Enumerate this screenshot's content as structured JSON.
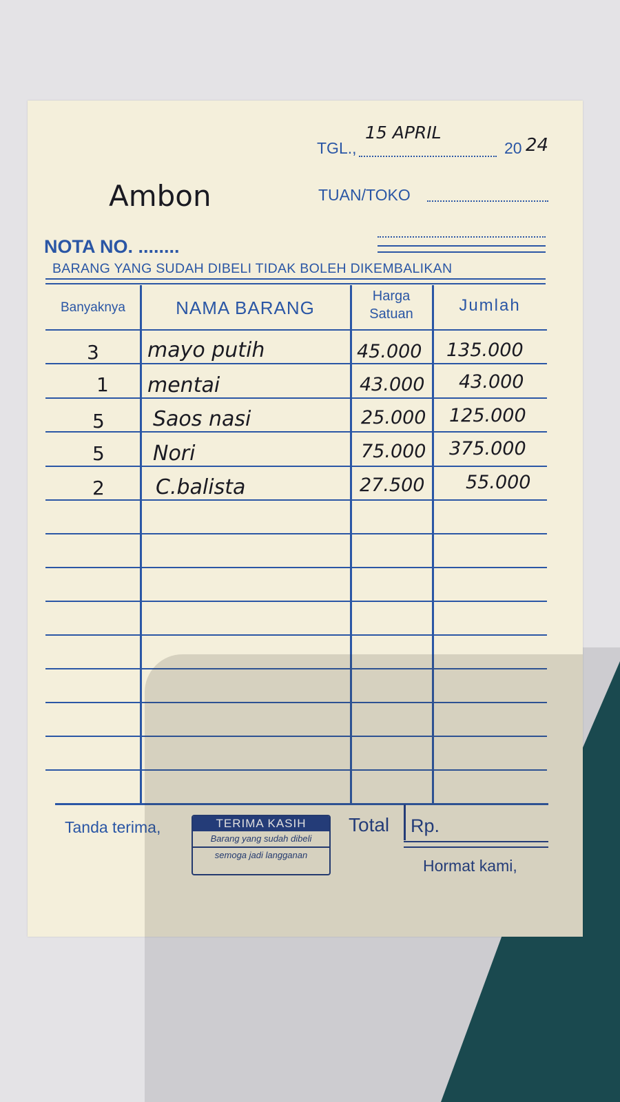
{
  "header": {
    "tgl_label": "TGL.,",
    "date_handwritten": "15 APRIL",
    "year_prefix": "20",
    "year_suffix": "24",
    "city_handwritten": "Ambon",
    "tuan_toko_label": "TUAN/TOKO",
    "nota_label": "NOTA NO. ........",
    "notice": "BARANG YANG SUDAH DIBELI TIDAK BOLEH DIKEMBALIKAN"
  },
  "table": {
    "columns": [
      "Banyaknya",
      "NAMA BARANG",
      "Harga",
      "Satuan",
      "Jumlah"
    ],
    "rows": [
      {
        "qty": "3",
        "name": "mayo putih",
        "price": "45.000",
        "amount": "135.000"
      },
      {
        "qty": "1",
        "name": "mentai",
        "price": "43.000",
        "amount": "43.000"
      },
      {
        "qty": "5",
        "name": "Saos nasi",
        "price": "25.000",
        "amount": "125.000"
      },
      {
        "qty": "5",
        "name": "Nori",
        "price": "75.000",
        "amount": "375.000"
      },
      {
        "qty": "2",
        "name": "C.balista",
        "price": "27.500",
        "amount": "55.000"
      }
    ]
  },
  "footer": {
    "tanda_terima": "Tanda terima,",
    "stamp_title": "TERIMA KASIH",
    "stamp_line1": "Barang yang sudah dibeli",
    "stamp_line2": "semoga jadi langganan",
    "total_label": "Total",
    "rp_label": "Rp.",
    "hormat_kami": "Hormat kami,"
  },
  "colors": {
    "print_blue": "#2a56a5",
    "paper": "#f4efdb",
    "ink": "#1a1a22"
  }
}
